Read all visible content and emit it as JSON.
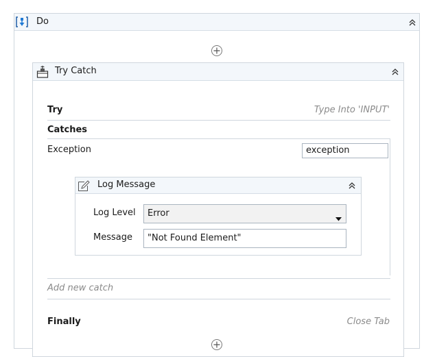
{
  "do_activity": {
    "title": "Do",
    "icon": "sequence-icon"
  },
  "try_catch": {
    "title": "Try Catch",
    "icon": "try-catch-icon",
    "try_label": "Try",
    "try_body": "Type Into 'INPUT'",
    "catches_label": "Catches",
    "exception_label": "Exception",
    "exception_var": "exception",
    "add_new_catch": "Add new catch",
    "finally_label": "Finally",
    "finally_body": "Close Tab"
  },
  "log_message": {
    "title": "Log Message",
    "icon": "log-message-icon",
    "log_level_label": "Log Level",
    "log_level_value": "Error",
    "message_label": "Message",
    "message_value": "\"Not Found Element\""
  },
  "colors": {
    "header_bg": "#f3f7fb",
    "border": "#cfd6dd",
    "sequence_icon_blue": "#1f7ad6"
  }
}
